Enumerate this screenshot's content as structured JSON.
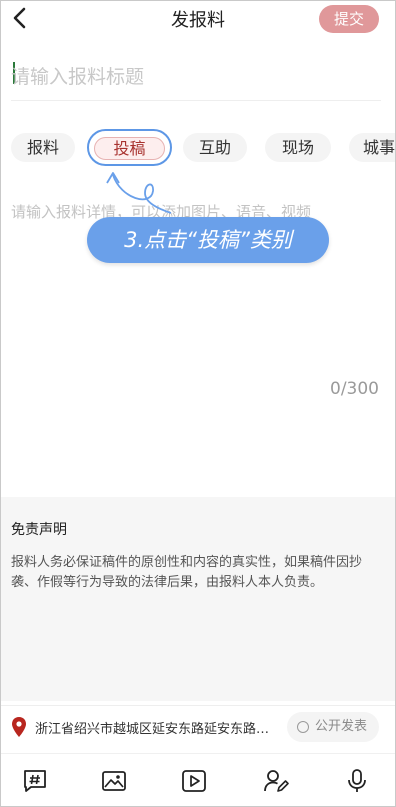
{
  "header": {
    "title": "发报料",
    "submit_label": "提交"
  },
  "title_input": {
    "placeholder": "请输入报料标题"
  },
  "tabs": [
    {
      "label": "报料",
      "active": false
    },
    {
      "label": "投稿",
      "active": true
    },
    {
      "label": "互助",
      "active": false
    },
    {
      "label": "现场",
      "active": false
    },
    {
      "label": "城事",
      "active": false
    }
  ],
  "detail": {
    "placeholder": "请输入报料详情，可以添加图片、语音、视频"
  },
  "tooltip": {
    "text": "3.点击“投稿”类别"
  },
  "counter": "0/300",
  "disclaimer": {
    "title": "免责声明",
    "body": "报料人务必保证稿件的原创性和内容的真实性，如果稿件因抄袭、作假等行为导致的法律后果，由报料人本人负责。"
  },
  "location": {
    "text": "浙江省绍兴市越城区延安东路延安东路…",
    "publish_label": "公开发表"
  },
  "colors": {
    "accent": "#a8322f",
    "submit_bg": "#e0989a",
    "tooltip_bg": "#6aa0ea",
    "ring": "#5d97e6"
  },
  "toolbar_icons": [
    "topic-icon",
    "image-icon",
    "video-icon",
    "user-edit-icon",
    "microphone-icon"
  ]
}
